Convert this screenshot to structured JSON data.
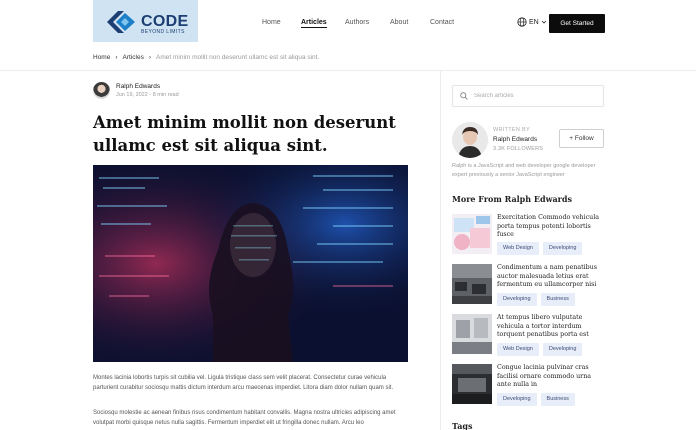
{
  "brand": {
    "name": "CODE",
    "tagline": "BEYOND LIMITS",
    "color": "#1c3e73",
    "accent": "#1d7fc7"
  },
  "nav": {
    "items": [
      "Home",
      "Articles",
      "Authors",
      "About",
      "Contact"
    ],
    "active": "Articles"
  },
  "lang": {
    "label": "EN"
  },
  "cta": {
    "label": "Get Started"
  },
  "breadcrumb": {
    "home": "Home",
    "section": "Articles",
    "current": "Amet minim mollit non deserunt ullamc est sit aliqua sint."
  },
  "article": {
    "author": "Ralph Edwards",
    "meta": "Jun 19, 2022 - 8 min read",
    "title": "Amet minim mollit non deserunt ullamc est sit aliqua sint.",
    "paragraphs": [
      "Montes lacinia lobortis turpis sit cubilia vel. Ligula tristique class sem velit placerat. Consectetur curae vehicula parturient curabitur sociosqu mattis dictum interdum arcu maecenas imperdiet. Litora diam dolor nullam quam sit.",
      "Sociosqu molestie ac aenean finibus risus condimentum habitant convallis. Magna nostra ultricies adipiscing amet volutpat morbi quisque netus nulla sagittis. Fermentum imperdiet elit ut fringilla donec nullam. Arcu leo"
    ]
  },
  "sidebar": {
    "search_placeholder": "Search articles",
    "written_by": "WRITTEN BY",
    "writer_name": "Ralph Edwards",
    "followers": "3.3K FOLLOWERS",
    "follow_label": "+ Follow",
    "bio": "Ralph is a JavaScript and web developer google developer expert previously a senior JavaScript engineer",
    "more_title": "More From Ralph Edwards",
    "cards": [
      {
        "title": "Exercitation Commodo vehicula porta tempus potenti lobortis fusce",
        "tags": [
          "Web Design",
          "Developing"
        ]
      },
      {
        "title": "Condimentum a nam penatibus auctor malesuada letius erat fermentum eu ullamcorper nisi",
        "tags": [
          "Developing",
          "Business"
        ]
      },
      {
        "title": "At tempus libero vulputate vehicula a tortor interdum torquent penatibus porta est",
        "tags": [
          "Web Design",
          "Developing"
        ]
      },
      {
        "title": "Congue lacinia pulvinar cras facilisi ornare commodo urna ante nulla in",
        "tags": [
          "Developing",
          "Business"
        ]
      }
    ],
    "tags_title": "Tags"
  }
}
